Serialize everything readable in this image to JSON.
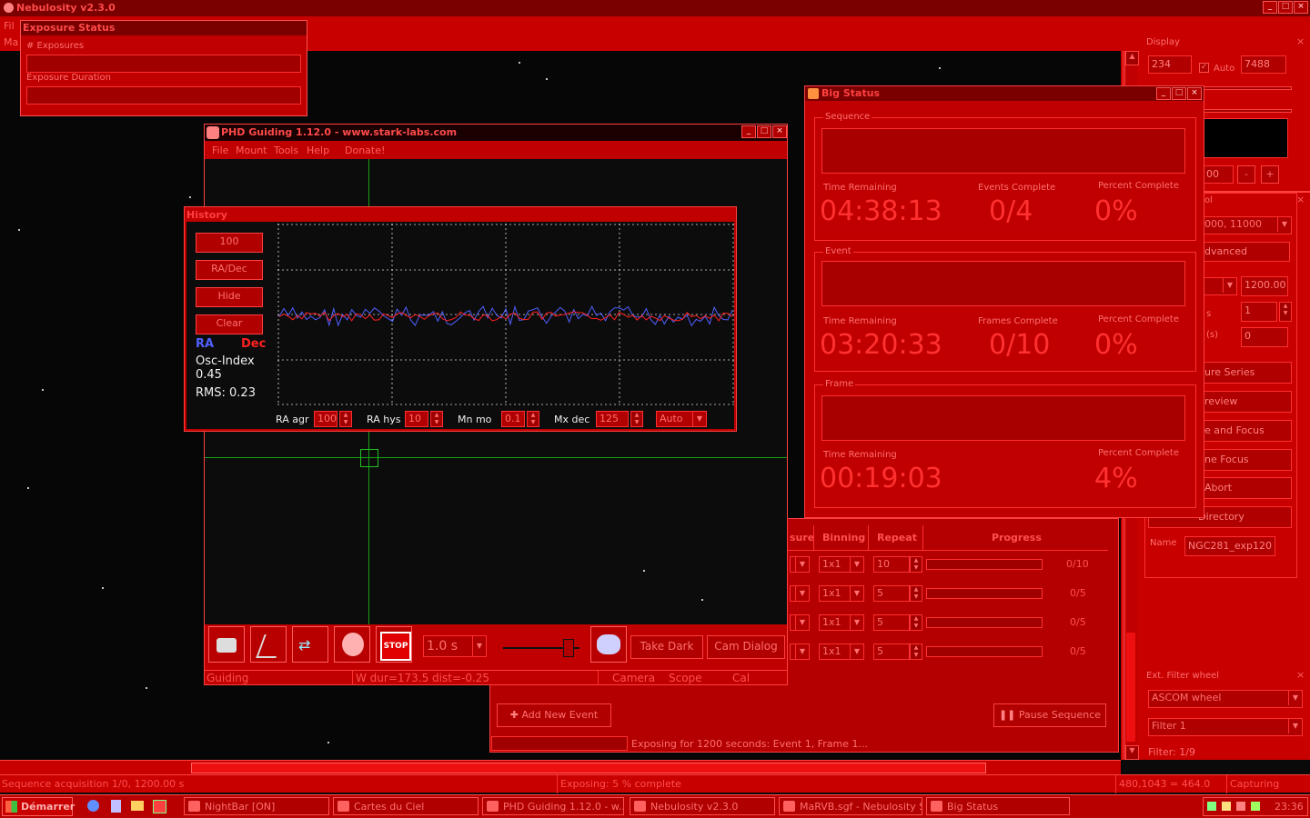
{
  "main_window": {
    "title": "Nebulosity v2.3.0",
    "menu_file": "Fil",
    "menu_ma": "Ma"
  },
  "exposure_status": {
    "title": "Exposure Status",
    "exposures_label": "# Exposures",
    "duration_label": "Exposure Duration"
  },
  "phd": {
    "title": "PHD Guiding 1.12.0  -  www.stark-labs.com",
    "menus": [
      "File",
      "Mount",
      "Tools",
      "Help",
      "Donate!"
    ],
    "exposure_value": "1.0 s",
    "take_dark": "Take Dark",
    "cam_dialog": "Cam Dialog",
    "status_guiding": "Guiding",
    "status_info": "W dur=173.5 dist=-0.25",
    "status_camera": "Camera",
    "status_scope": "Scope",
    "status_cal": "Cal"
  },
  "history": {
    "title": "History",
    "buttons": [
      "100",
      "RA/Dec",
      "Hide",
      "Clear"
    ],
    "ra_label": "RA",
    "dec_label": "Dec",
    "osc_label": "Osc-Index",
    "osc_value": "0.45",
    "rms": "RMS: 0.23",
    "ra_agr_label": "RA agr",
    "ra_agr_value": "100",
    "ra_hys_label": "RA hys",
    "ra_hys_value": "10",
    "mn_mo_label": "Mn mo",
    "mn_mo_value": "0.1",
    "mx_dec_label": "Mx dec",
    "mx_dec_value": "125",
    "dec_mode": "Auto",
    "colors": {
      "ra": "#5060ff",
      "dec": "#ff2020"
    }
  },
  "big_status": {
    "title": "Big Status",
    "sequence_label": "Sequence",
    "event_label": "Event",
    "frame_label": "Frame",
    "seq_time_label": "Time Remaining",
    "seq_events_label": "Events Complete",
    "seq_pct_label": "Percent Complete",
    "seq_time": "04:38:13",
    "seq_events": "0/4",
    "seq_pct": "0%",
    "evt_time_label": "Time Remaining",
    "evt_frames_label": "Frames Complete",
    "evt_pct_label": "Percent Complete",
    "evt_time": "03:20:33",
    "evt_frames": "0/10",
    "evt_pct": "0%",
    "frm_time_label": "Time Remaining",
    "frm_pct_label": "Percent Complete",
    "frm_time": "00:19:03",
    "frm_pct": "4%"
  },
  "display_panel": {
    "title": "Display",
    "min": "234",
    "auto_label": "Auto",
    "max": "7488",
    "small_val": "00",
    "range": "000, 11000",
    "advanced": "dvanced",
    "duration": "1200.00",
    "s_label": "s",
    "count": "1",
    "s2_label": "(s)",
    "delay": "0",
    "btn1": "ure Series",
    "btn2": "review",
    "btn3": "e and Focus",
    "btn4": "ne Focus",
    "btn5": "Abort",
    "btn6": "Directory",
    "name_label": "Name",
    "name_value": "NGC281_exp120",
    "ol_label": "ol"
  },
  "sequence_table": {
    "headers": [
      "sure",
      "Binning",
      "Repeat",
      "Progress"
    ],
    "rows": [
      {
        "binning": "1x1",
        "repeat": "10",
        "count": "0/10"
      },
      {
        "binning": "1x1",
        "repeat": "5",
        "count": "0/5"
      },
      {
        "binning": "1x1",
        "repeat": "5",
        "count": "0/5"
      },
      {
        "binning": "1x1",
        "repeat": "5",
        "count": "0/5"
      }
    ],
    "add_event": "Add New Event",
    "pause": "Pause Sequence",
    "status": "Exposing for 1200 seconds: Event 1, Frame 1..."
  },
  "filter_wheel": {
    "title": "Ext. Filter wheel",
    "device": "ASCOM wheel",
    "filter": "Filter 1",
    "status": "Filter: 1/9"
  },
  "statusbar": {
    "left": "Sequence acquisition 1/0, 1200.00 s",
    "middle": "Exposing: 5 % complete",
    "coords": "480,1043 = 464.0",
    "state": "Capturing"
  },
  "taskbar": {
    "start": "Démarrer",
    "items": [
      "NightBar [ON]",
      "Cartes du Ciel",
      "PHD Guiding 1.12.0  -  w...",
      "Nebulosity v2.3.0",
      "MaRVB.sgf - Nebulosity S...",
      "Big Status"
    ],
    "clock": "23:36"
  }
}
